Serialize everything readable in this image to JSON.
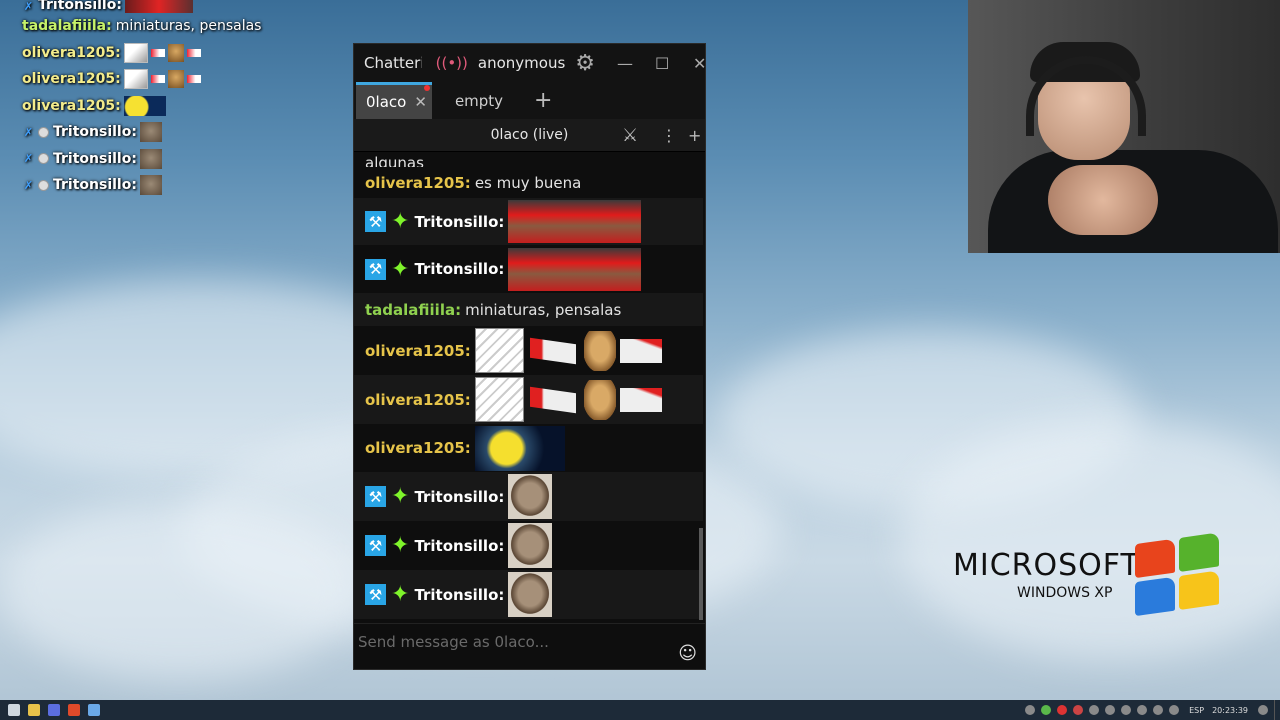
{
  "overlay": {
    "lines": [
      {
        "name": "Tritonsillo",
        "msg": ""
      },
      {
        "name": "tadalafiiila",
        "msg": "miniaturas, pensalas"
      },
      {
        "name": "olivera1205",
        "msg": ""
      },
      {
        "name": "olivera1205",
        "msg": ""
      },
      {
        "name": "olivera1205",
        "msg": ""
      },
      {
        "name": "Tritonsillo",
        "msg": ""
      },
      {
        "name": "Tritonsillo",
        "msg": ""
      },
      {
        "name": "Tritonsillo",
        "msg": ""
      }
    ]
  },
  "window": {
    "app_title": "Chatterino",
    "live_icon": "((•))",
    "account": "anonymous",
    "tabs": [
      {
        "label": "0laco"
      },
      {
        "label": "empty"
      }
    ],
    "add_tab": "+",
    "channel_header": "0laco (live)",
    "messages": [
      {
        "name": "",
        "text": "algunas"
      },
      {
        "name": "olivera1205:",
        "text": "es muy buena"
      },
      {
        "name": "Tritonsillo:",
        "text": ""
      },
      {
        "name": "Tritonsillo:",
        "text": ""
      },
      {
        "name": "tadalafiiila:",
        "text": "miniaturas, pensalas"
      },
      {
        "name": "olivera1205:",
        "text": ""
      },
      {
        "name": "olivera1205:",
        "text": ""
      },
      {
        "name": "olivera1205:",
        "text": ""
      },
      {
        "name": "Tritonsillo:",
        "text": ""
      },
      {
        "name": "Tritonsillo:",
        "text": ""
      },
      {
        "name": "Tritonsillo:",
        "text": ""
      }
    ],
    "input_placeholder": "Send message as 0laco..."
  },
  "desktop": {
    "xp_brand": "MICROSOFT",
    "xp_sub": "WINDOWS XP"
  },
  "taskbar": {
    "lang": "ESP",
    "clock": "20:23:39"
  },
  "colors": {
    "accent": "#3fa7e0",
    "name_olivera": "#e6c44a",
    "name_tadalafiiila": "#8fd14f",
    "name_tritonsillo": "#ffffff"
  }
}
